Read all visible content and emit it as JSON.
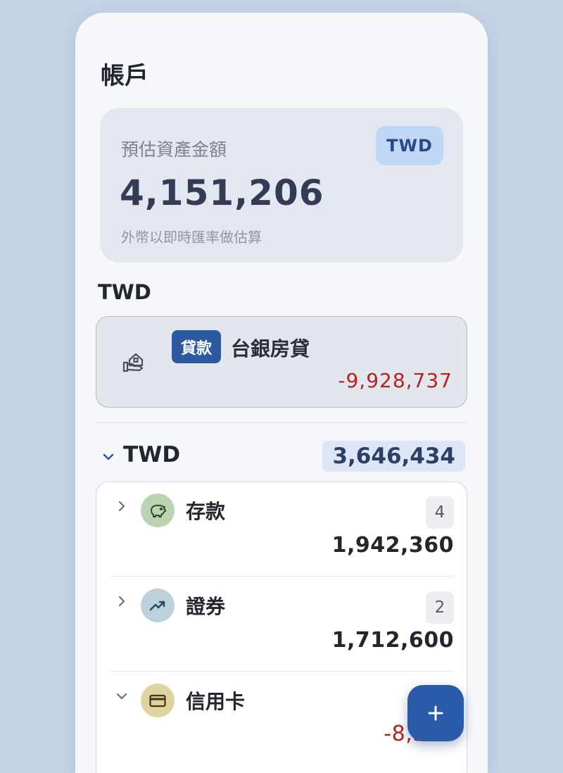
{
  "header": {
    "title": "帳戶"
  },
  "summary": {
    "label": "預估資產金額",
    "currency": "TWD",
    "amount": "4,151,206",
    "note": "外幣以即時匯率做估算"
  },
  "section": {
    "title": "TWD"
  },
  "loan": {
    "badge": "貸款",
    "name": "台銀房貸",
    "value": "-9,928,737",
    "icon": "home-hand-icon"
  },
  "group": {
    "name": "TWD",
    "total": "3,646,434",
    "items": [
      {
        "name": "存款",
        "count": "4",
        "value": "1,942,360",
        "icon": "piggy-bank-icon",
        "icon_bg": "#b9d3b3"
      },
      {
        "name": "證券",
        "count": "2",
        "value": "1,712,600",
        "icon": "trending-up-icon",
        "icon_bg": "#bcd1dc"
      },
      {
        "name": "信用卡",
        "value": "-8,320",
        "icon": "credit-card-icon",
        "icon_bg": "#dfd3a0"
      }
    ]
  },
  "fab": {
    "label": "+"
  },
  "colors": {
    "accent": "#2b5aa1",
    "negative": "#b6221d",
    "background": "#c3d3e6"
  }
}
